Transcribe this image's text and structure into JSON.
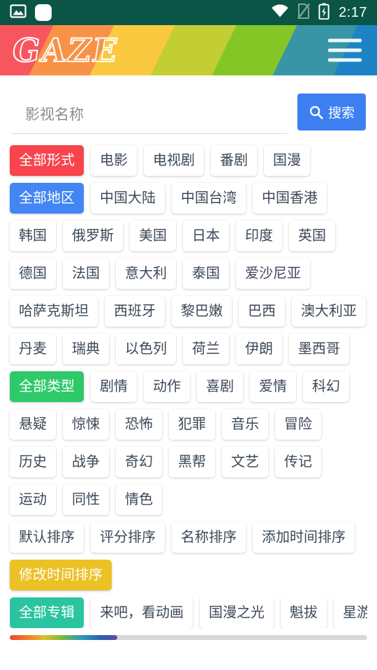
{
  "status_bar": {
    "time": "2:17",
    "icons": [
      "image-icon",
      "notification-square-icon",
      "wifi-icon",
      "sim-off-icon",
      "battery-charging-icon"
    ],
    "background_color": "#0a5546"
  },
  "header": {
    "logo_text": "GAZE",
    "menu_label": "menu",
    "stripe_colors": [
      "#f8565f",
      "#f89246",
      "#fbc940",
      "#c3ce35",
      "#84c626",
      "#3895a5",
      "#1c84c6"
    ]
  },
  "search": {
    "placeholder": "影视名称",
    "value": "",
    "button_label": "搜索",
    "button_color": "#3d7ef0"
  },
  "filters": [
    {
      "group": "form",
      "active_color": "#f9444d",
      "chips": [
        {
          "label": "全部形式",
          "active": true
        },
        {
          "label": "电影",
          "active": false
        },
        {
          "label": "电视剧",
          "active": false
        },
        {
          "label": "番剧",
          "active": false
        },
        {
          "label": "国漫",
          "active": false
        }
      ]
    },
    {
      "group": "region",
      "active_color": "#4285f4",
      "chips": [
        {
          "label": "全部地区",
          "active": true
        },
        {
          "label": "中国大陆",
          "active": false
        },
        {
          "label": "中国台湾",
          "active": false
        },
        {
          "label": "中国香港",
          "active": false
        },
        {
          "label": "韩国",
          "active": false
        },
        {
          "label": "俄罗斯",
          "active": false
        },
        {
          "label": "美国",
          "active": false
        },
        {
          "label": "日本",
          "active": false
        },
        {
          "label": "印度",
          "active": false
        },
        {
          "label": "英国",
          "active": false
        },
        {
          "label": "德国",
          "active": false
        },
        {
          "label": "法国",
          "active": false
        },
        {
          "label": "意大利",
          "active": false
        },
        {
          "label": "泰国",
          "active": false
        },
        {
          "label": "爱沙尼亚",
          "active": false
        },
        {
          "label": "哈萨克斯坦",
          "active": false
        },
        {
          "label": "西班牙",
          "active": false
        },
        {
          "label": "黎巴嫩",
          "active": false
        },
        {
          "label": "巴西",
          "active": false
        },
        {
          "label": "澳大利亚",
          "active": false
        },
        {
          "label": "丹麦",
          "active": false
        },
        {
          "label": "瑞典",
          "active": false
        },
        {
          "label": "以色列",
          "active": false
        },
        {
          "label": "荷兰",
          "active": false
        },
        {
          "label": "伊朗",
          "active": false
        },
        {
          "label": "墨西哥",
          "active": false
        }
      ]
    },
    {
      "group": "genre",
      "active_color": "#2fc96a",
      "chips": [
        {
          "label": "全部类型",
          "active": true
        },
        {
          "label": "剧情",
          "active": false
        },
        {
          "label": "动作",
          "active": false
        },
        {
          "label": "喜剧",
          "active": false
        },
        {
          "label": "爱情",
          "active": false
        },
        {
          "label": "科幻",
          "active": false
        },
        {
          "label": "悬疑",
          "active": false
        },
        {
          "label": "惊悚",
          "active": false
        },
        {
          "label": "恐怖",
          "active": false
        },
        {
          "label": "犯罪",
          "active": false
        },
        {
          "label": "音乐",
          "active": false
        },
        {
          "label": "冒险",
          "active": false
        },
        {
          "label": "历史",
          "active": false
        },
        {
          "label": "战争",
          "active": false
        },
        {
          "label": "奇幻",
          "active": false
        },
        {
          "label": "黑帮",
          "active": false
        },
        {
          "label": "文艺",
          "active": false
        },
        {
          "label": "传记",
          "active": false
        },
        {
          "label": "运动",
          "active": false
        },
        {
          "label": "同性",
          "active": false
        },
        {
          "label": "情色",
          "active": false
        }
      ]
    },
    {
      "group": "sort",
      "active_color": "#ebc126",
      "chips": [
        {
          "label": "默认排序",
          "active": false
        },
        {
          "label": "评分排序",
          "active": false
        },
        {
          "label": "名称排序",
          "active": false
        },
        {
          "label": "添加时间排序",
          "active": false
        },
        {
          "label": "修改时间排序",
          "active": true
        }
      ]
    },
    {
      "group": "album",
      "active_color": "#2bc4a0",
      "chips": [
        {
          "label": "全部专辑",
          "active": true
        },
        {
          "label": "来吧，看动画",
          "active": false
        },
        {
          "label": "国漫之光",
          "active": false
        },
        {
          "label": "魁拔",
          "active": false
        },
        {
          "label": "星游",
          "active": false
        }
      ]
    }
  ],
  "scrollbar": {
    "thumb_percent": 30,
    "gradient": "red-orange-yellow-green-teal-blue-purple"
  }
}
